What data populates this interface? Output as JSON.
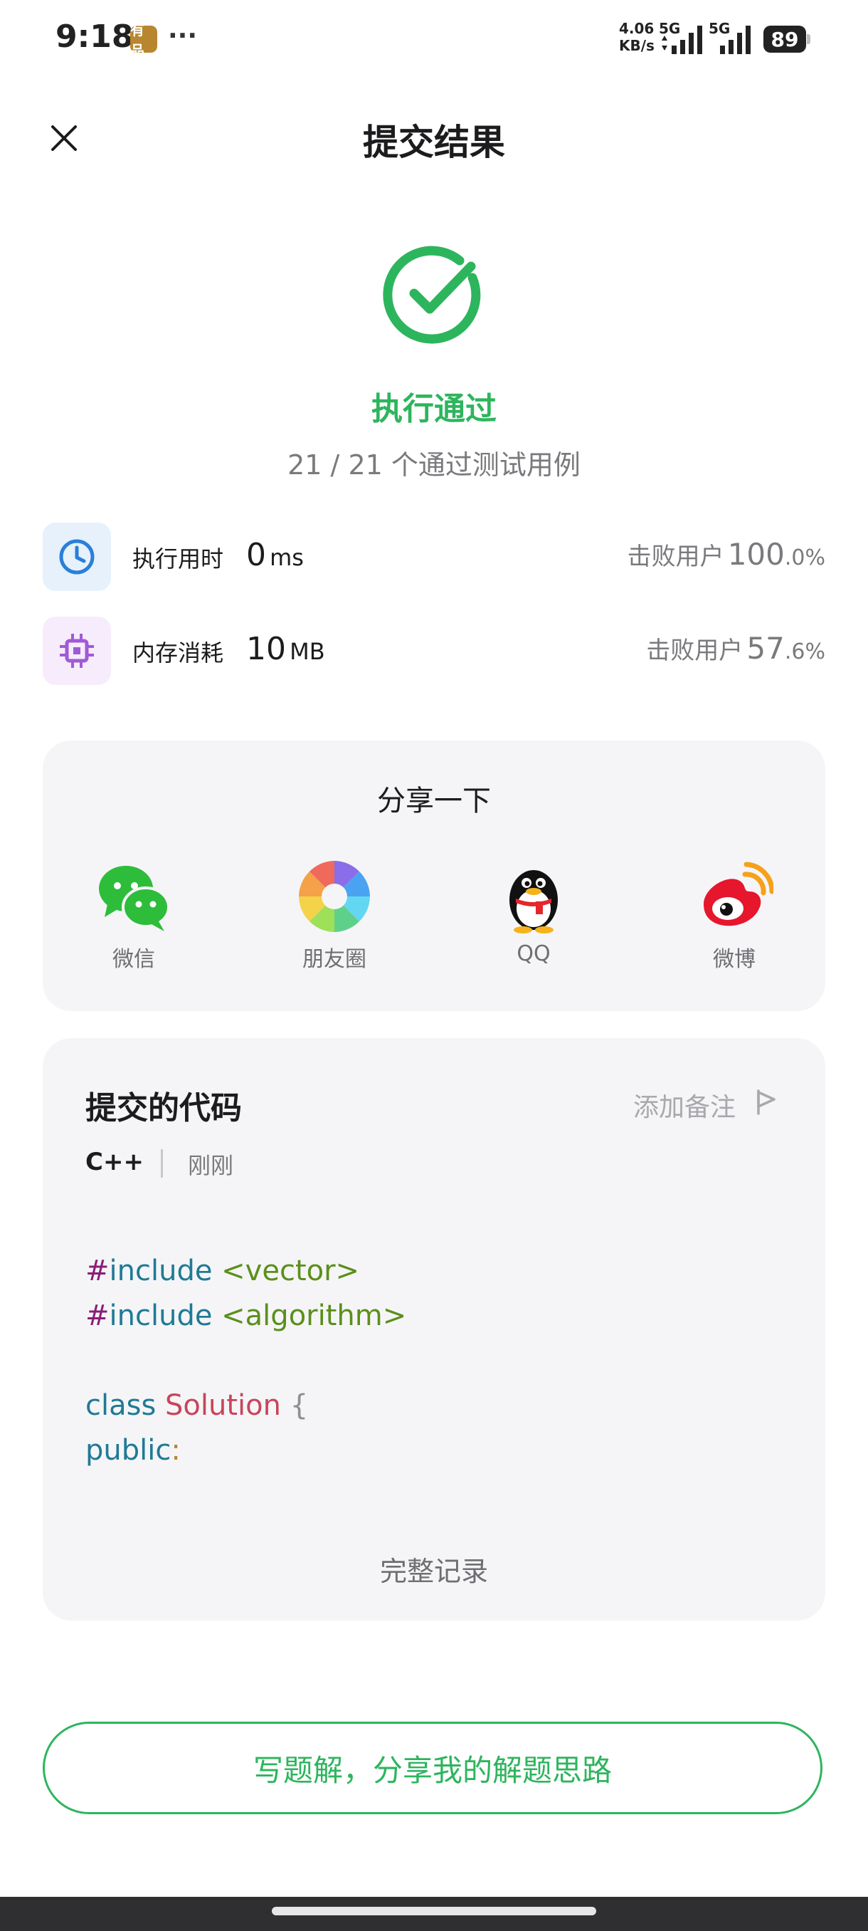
{
  "status_bar": {
    "time": "9:18",
    "app_badge": "有品",
    "more": "···",
    "speed_value": "4.06",
    "speed_unit": "KB/s",
    "network1": "5G",
    "network2": "5G",
    "battery": "89"
  },
  "header": {
    "title": "提交结果"
  },
  "result": {
    "status": "执行通过",
    "tests": "21 / 21 个通过测试用例",
    "accent": "#2db55d"
  },
  "stats": {
    "time": {
      "label": "执行用时",
      "value": "0",
      "unit": "ms",
      "beat_label": "击败用户",
      "beat_big": "100",
      "beat_small": ".0%"
    },
    "memory": {
      "label": "内存消耗",
      "value": "10",
      "unit": "MB",
      "beat_label": "击败用户",
      "beat_big": "57",
      "beat_small": ".6%"
    }
  },
  "share": {
    "title": "分享一下",
    "items": [
      {
        "label": "微信",
        "icon": "wechat-icon"
      },
      {
        "label": "朋友圈",
        "icon": "moments-icon"
      },
      {
        "label": "QQ",
        "icon": "qq-icon"
      },
      {
        "label": "微博",
        "icon": "weibo-icon"
      }
    ]
  },
  "code": {
    "title": "提交的代码",
    "add_note": "添加备注",
    "language": "C++",
    "time": "刚刚",
    "lines": {
      "l1_dir": "#",
      "l1_kw": "include",
      "l1_str": "<vector>",
      "l2_dir": "#",
      "l2_kw": "include",
      "l2_str": "<algorithm>",
      "l4_kw": "class",
      "l4_cls": "Solution",
      "l4_punc": "{",
      "l5_kw": "public",
      "l5_colon": ":"
    },
    "full_record": "完整记录"
  },
  "bottom_button": {
    "label": "写题解，分享我的解题思路"
  }
}
